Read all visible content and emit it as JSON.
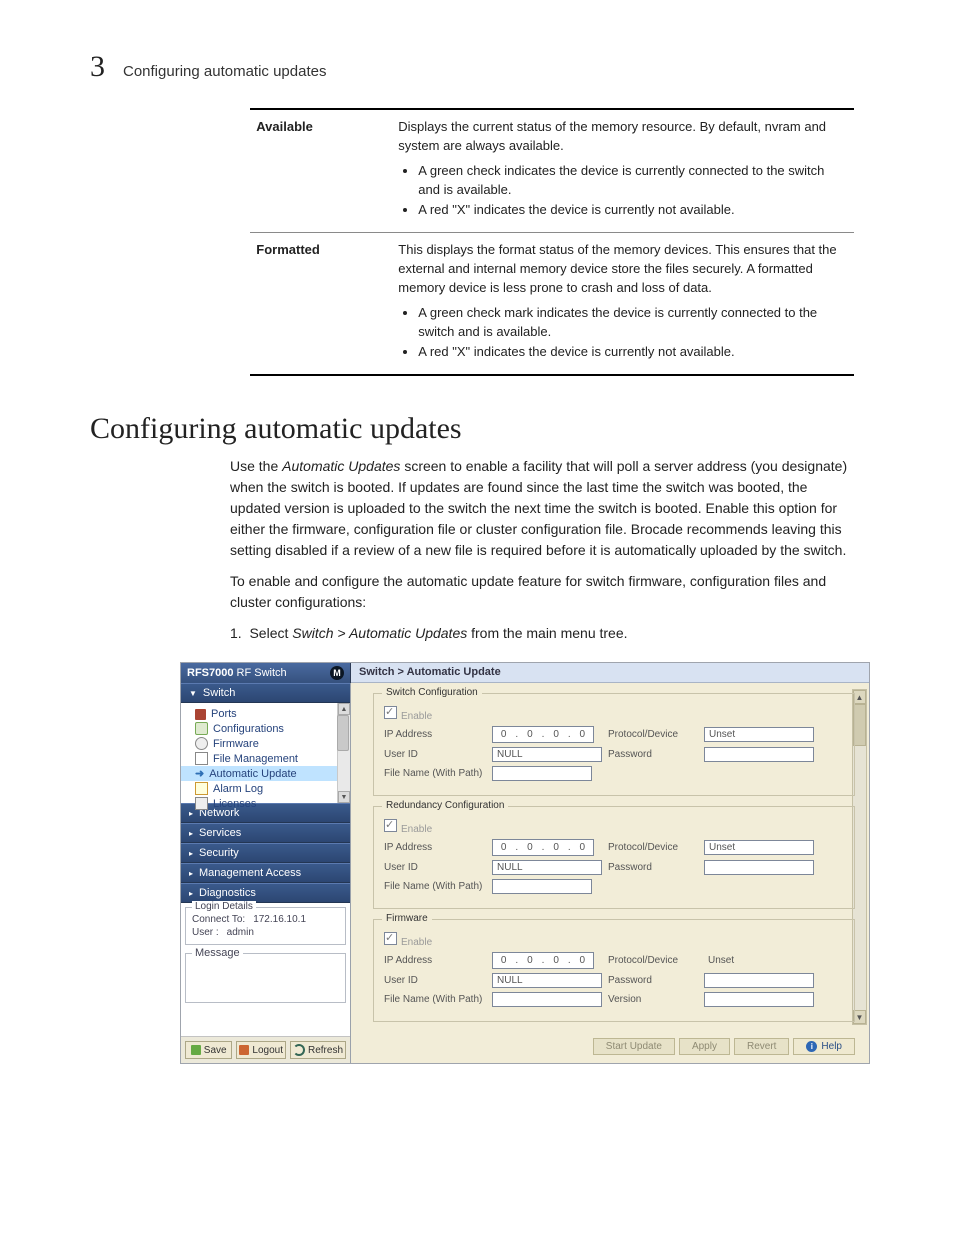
{
  "header": {
    "chapter_number": "3",
    "chapter_title": "Configuring automatic updates"
  },
  "table": {
    "rows": [
      {
        "key": "Available",
        "text": "Displays the current status of the memory resource. By default, nvram and system are always available.",
        "bullets": [
          "A green check indicates the device is currently connected to the switch and is available.",
          "A red \"X\" indicates the device is currently not available."
        ]
      },
      {
        "key": "Formatted",
        "text": "This displays the format status of the memory devices. This ensures that the external and internal memory device store the files securely. A formatted memory device is less prone to crash and loss of data.",
        "bullets": [
          "A green check mark indicates the device is currently connected to the switch and is available.",
          "A red \"X\" indicates the device is currently not available."
        ]
      }
    ]
  },
  "section_title": "Configuring automatic updates",
  "para1_a": "Use the ",
  "para1_em": "Automatic Updates",
  "para1_b": " screen to enable a facility that will poll a server address (you designate) when the switch is booted. If updates are found since the last time the switch was booted, the updated version is uploaded to the switch the next time the switch is booted. Enable this option for either the firmware, configuration file or cluster configuration file. Brocade recommends leaving this setting disabled if a review of a new file is required before it is automatically uploaded by the switch.",
  "para2": "To enable and configure the automatic update feature for switch firmware, configuration files and cluster configurations:",
  "step1_a": "Select ",
  "step1_em": "Switch > Automatic Updates",
  "step1_b": " from the main menu tree.",
  "shot": {
    "product_a": "RFS7000",
    "product_b": " RF Switch",
    "breadcrumb": "Switch > Automatic Update",
    "side": {
      "section_open": "Switch",
      "tree": [
        {
          "label": "Ports"
        },
        {
          "label": "Configurations"
        },
        {
          "label": "Firmware"
        },
        {
          "label": "File Management"
        },
        {
          "label": "Automatic Update"
        },
        {
          "label": "Alarm Log"
        },
        {
          "label": "Licenses"
        }
      ],
      "sections_closed": [
        "Network",
        "Services",
        "Security",
        "Management Access",
        "Diagnostics"
      ],
      "login_legend": "Login Details",
      "connect_lbl": "Connect To:",
      "connect_val": "172.16.10.1",
      "user_lbl": "User :",
      "user_val": "admin",
      "message_legend": "Message",
      "btn_save": "Save",
      "btn_logout": "Logout",
      "btn_refresh": "Refresh"
    },
    "main": {
      "groups": [
        {
          "legend": "Switch Configuration",
          "enable": "Enable",
          "ip_lbl": "IP Address",
          "ip": [
            "0",
            "0",
            "0",
            "0"
          ],
          "proto_lbl": "Protocol/Device",
          "proto_val": "Unset",
          "uid_lbl": "User ID",
          "uid_val": "NULL",
          "pwd_lbl": "Password",
          "pwd_val": "",
          "file_lbl": "File Name (With Path)",
          "file_val": ""
        },
        {
          "legend": "Redundancy Configuration",
          "enable": "Enable",
          "ip_lbl": "IP Address",
          "ip": [
            "0",
            "0",
            "0",
            "0"
          ],
          "proto_lbl": "Protocol/Device",
          "proto_val": "Unset",
          "uid_lbl": "User ID",
          "uid_val": "NULL",
          "pwd_lbl": "Password",
          "pwd_val": "",
          "file_lbl": "File Name (With Path)",
          "file_val": ""
        },
        {
          "legend": "Firmware",
          "enable": "Enable",
          "ip_lbl": "IP Address",
          "ip": [
            "0",
            "0",
            "0",
            "0"
          ],
          "proto_lbl": "Protocol/Device",
          "proto_val": "Unset",
          "uid_lbl": "User ID",
          "uid_val": "NULL",
          "pwd_lbl": "Password",
          "pwd_val": "",
          "file_lbl": "File Name (With Path)",
          "file_val": "",
          "ver_lbl": "Version",
          "ver_val": ""
        }
      ],
      "footer": {
        "start": "Start Update",
        "apply": "Apply",
        "revert": "Revert",
        "help": "Help"
      }
    }
  }
}
